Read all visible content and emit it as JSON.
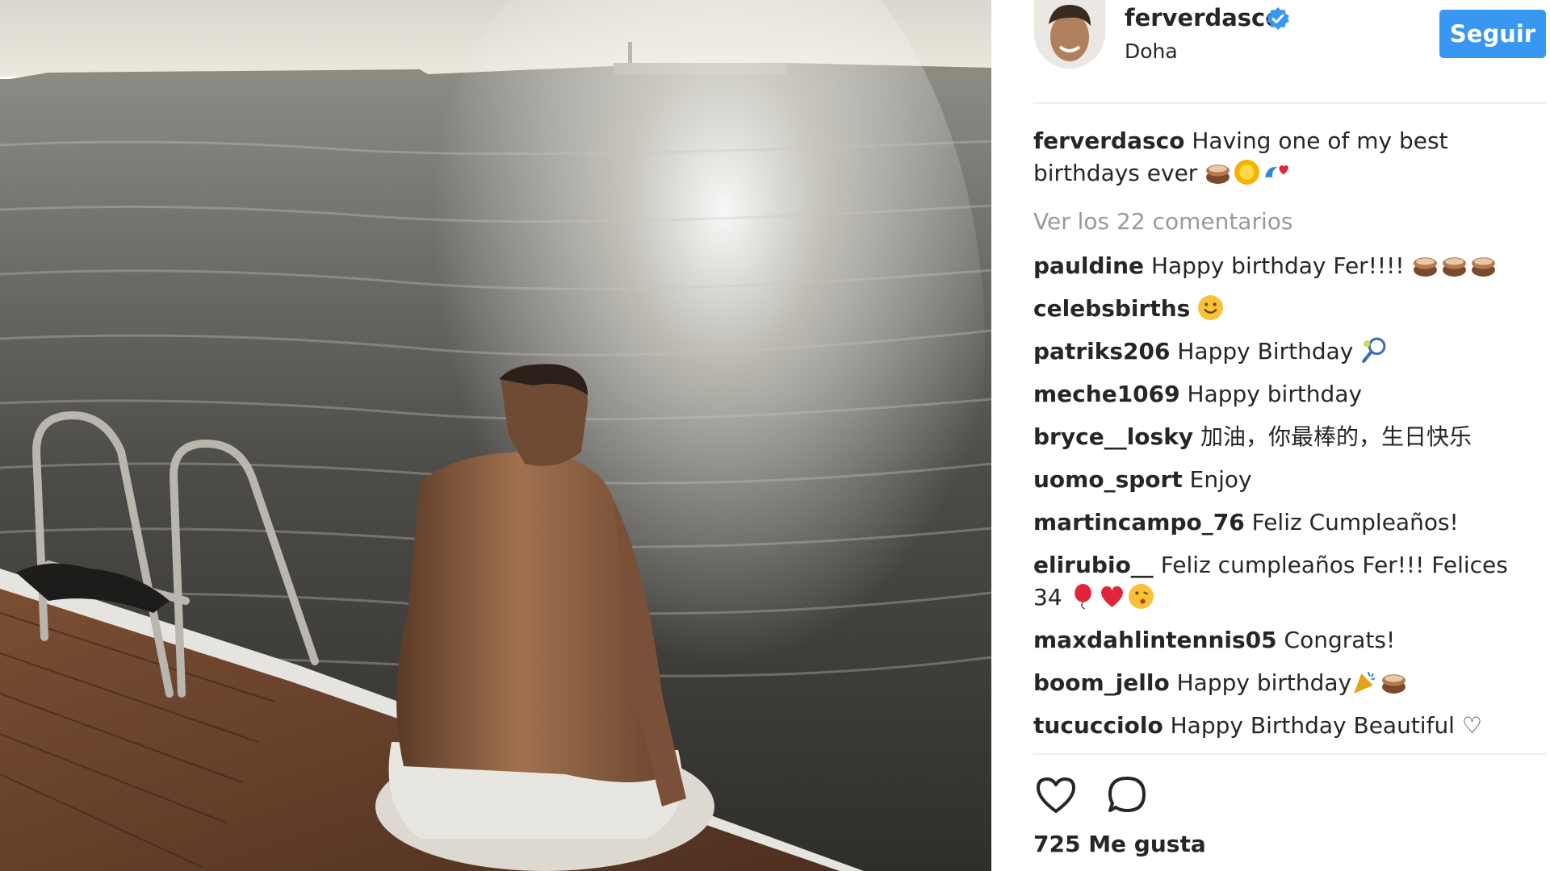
{
  "post": {
    "username": "ferverdasco",
    "location": "Doha",
    "follow_label": "Seguir",
    "caption_text": "Having one of my best birthdays ever",
    "caption_emojis": [
      "cake",
      "sun",
      "wave-heart"
    ],
    "view_comments_label": "Ver los 22 comentarios",
    "likes_label": "725 Me gusta"
  },
  "comments": [
    {
      "user": "pauldine",
      "text": "Happy birthday Fer!!!!",
      "emojis": [
        "cake",
        "cake",
        "cake"
      ]
    },
    {
      "user": "celebsbirths",
      "text": "",
      "emojis": [
        "smile"
      ]
    },
    {
      "user": "patriks206",
      "text": "Happy Birthday",
      "emojis": [
        "tennis"
      ]
    },
    {
      "user": "meche1069",
      "text": "Happy birthday",
      "emojis": []
    },
    {
      "user": "bryce__losky",
      "text": "加油，你最棒的，生日快乐",
      "emojis": []
    },
    {
      "user": "uomo_sport",
      "text": "Enjoy",
      "emojis": []
    },
    {
      "user": "martincampo_76",
      "text": "Feliz Cumpleaños!",
      "emojis": []
    },
    {
      "user": "elirubio__",
      "text": "Feliz cumpleaños Fer!!! Felices 34",
      "emojis": [
        "balloon",
        "heart",
        "kiss"
      ]
    },
    {
      "user": "maxdahlintennis05",
      "text": "Congrats!",
      "emojis": []
    },
    {
      "user": "boom_jello",
      "text": "Happy birthday",
      "emojis": [
        "party",
        "cake"
      ]
    },
    {
      "user": "tucucciolo",
      "text": "Happy Birthday Beautiful ♡",
      "emojis": []
    }
  ],
  "icons": {
    "like": "heart-outline-icon",
    "comment": "speech-bubble-icon",
    "verified": "verified-badge-icon"
  },
  "colors": {
    "follow_button": "#3897f0",
    "verified_badge": "#3897f0",
    "muted_text": "#999999",
    "text": "#262626"
  }
}
